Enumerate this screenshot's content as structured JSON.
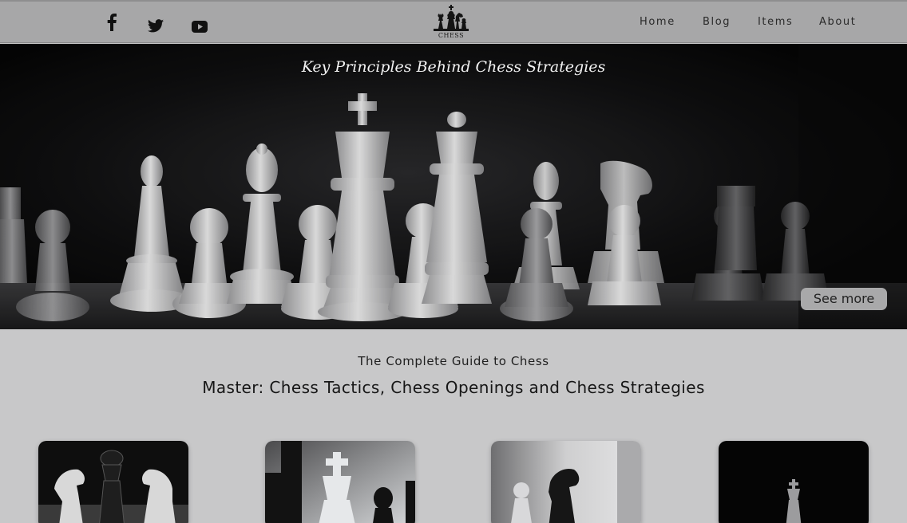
{
  "header": {
    "social": [
      {
        "name": "facebook-icon"
      },
      {
        "name": "twitter-icon"
      },
      {
        "name": "youtube-icon"
      }
    ],
    "logo_text": "CHESS",
    "nav": [
      "Home",
      "Blog",
      "Items",
      "About"
    ]
  },
  "hero": {
    "title": "Key Principles Behind Chess Strategies",
    "button_label": "See more"
  },
  "intro": {
    "subtitle": "The Complete Guide to Chess",
    "headline": "Master: Chess Tactics, Chess Openings and Chess Strategies"
  },
  "cards": [
    {
      "name": "card-knights-queen"
    },
    {
      "name": "card-king-closeup"
    },
    {
      "name": "card-knight-pawn"
    },
    {
      "name": "card-dark-king"
    }
  ],
  "colors": {
    "header_bg": "#a7a7a8",
    "page_bg": "#c8c8c9",
    "button_bg": "#a9a9aa"
  }
}
